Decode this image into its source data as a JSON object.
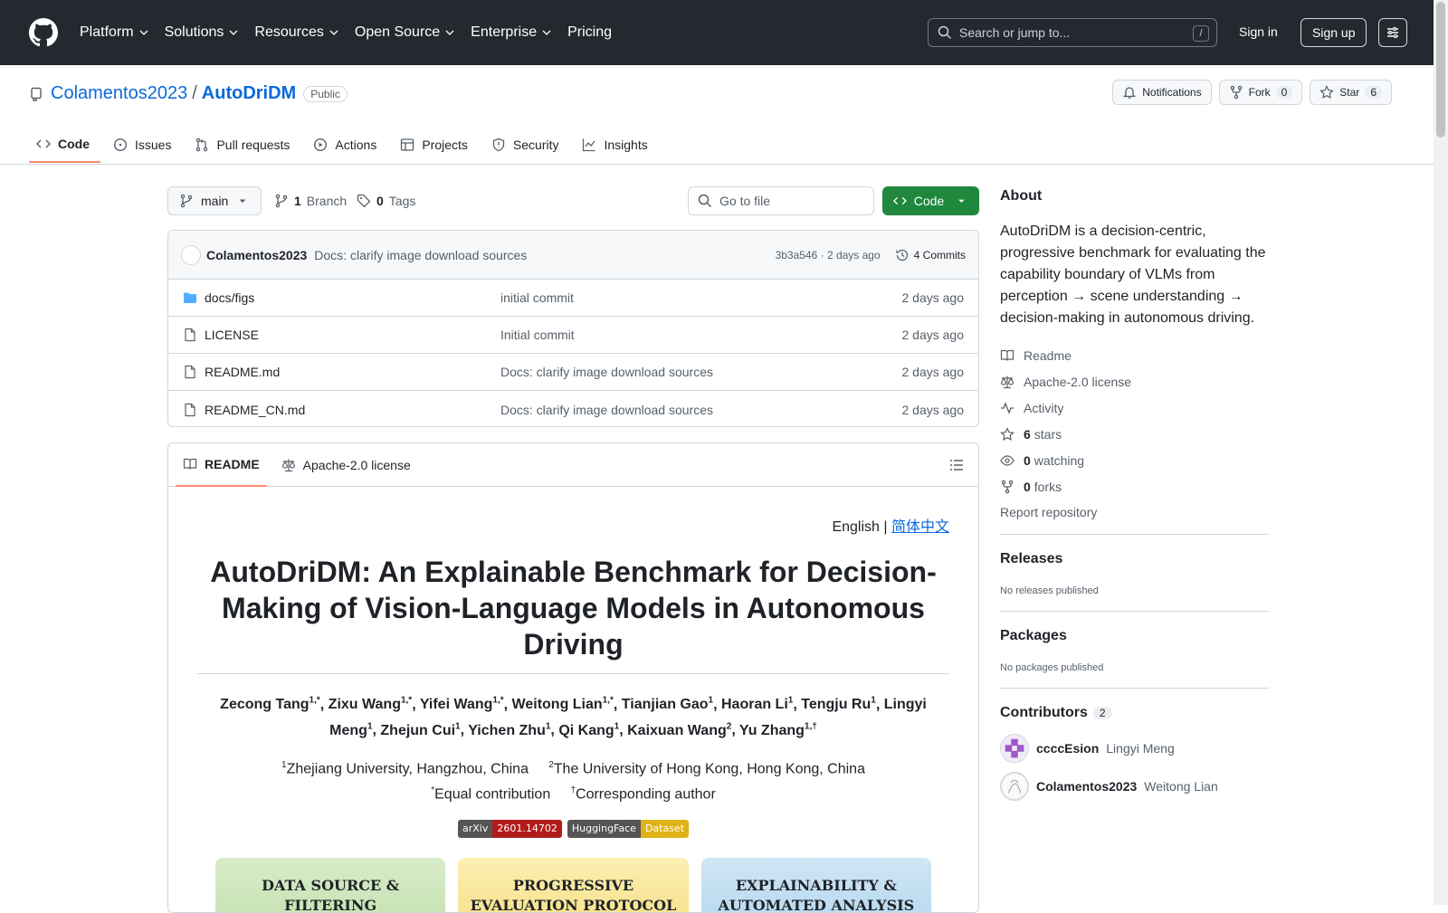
{
  "header": {
    "nav": [
      "Platform",
      "Solutions",
      "Resources",
      "Open Source",
      "Enterprise",
      "Pricing"
    ],
    "search_placeholder": "Search or jump to...",
    "search_shortcut": "/",
    "signin": "Sign in",
    "signup": "Sign up"
  },
  "repo": {
    "owner": "Colamentos2023",
    "separator": "/",
    "name": "AutoDriDM",
    "visibility": "Public",
    "notifications": "Notifications",
    "fork_label": "Fork",
    "fork_count": "0",
    "star_label": "Star",
    "star_count": "6"
  },
  "tabs": [
    "Code",
    "Issues",
    "Pull requests",
    "Actions",
    "Projects",
    "Security",
    "Insights"
  ],
  "toolbar": {
    "branch": "main",
    "branch_count": "1",
    "branch_label": "Branch",
    "tag_count": "0",
    "tag_label": "Tags",
    "goto_file": "Go to file",
    "code_button": "Code"
  },
  "commit": {
    "author": "Colamentos2023",
    "message": "Docs: clarify image download sources",
    "hash_time": "3b3a546 · 2 days ago",
    "commits": "4 Commits"
  },
  "files": [
    {
      "name": "docs/figs",
      "type": "folder",
      "message": "initial commit",
      "date": "2 days ago"
    },
    {
      "name": "LICENSE",
      "type": "file",
      "message": "Initial commit",
      "date": "2 days ago"
    },
    {
      "name": "README.md",
      "type": "file",
      "message": "Docs: clarify image download sources",
      "date": "2 days ago"
    },
    {
      "name": "README_CN.md",
      "type": "file",
      "message": "Docs: clarify image download sources",
      "date": "2 days ago"
    }
  ],
  "readme": {
    "tab_readme": "README",
    "tab_license": "Apache-2.0 license",
    "lang_english": "English |",
    "lang_chinese": "简体中文",
    "title": "AutoDriDM: An Explainable Benchmark for Decision-Making of Vision-Language Models in Autonomous Driving",
    "authors": [
      {
        "name": "Zecong Tang",
        "sup": "1,*"
      },
      {
        "name": "Zixu Wang",
        "sup": "1,*"
      },
      {
        "name": "Yifei Wang",
        "sup": "1,*"
      },
      {
        "name": "Weitong Lian",
        "sup": "1,*"
      },
      {
        "name": "Tianjian Gao",
        "sup": "1"
      },
      {
        "name": "Haoran Li",
        "sup": "1"
      },
      {
        "name": "Tengju Ru",
        "sup": "1"
      },
      {
        "name": "Lingyi Meng",
        "sup": "1"
      },
      {
        "name": "Zhejun Cui",
        "sup": "1"
      },
      {
        "name": "Yichen Zhu",
        "sup": "1"
      },
      {
        "name": "Qi Kang",
        "sup": "1"
      },
      {
        "name": "Kaixuan Wang",
        "sup": "2"
      },
      {
        "name": "Yu Zhang",
        "sup": "1,†"
      }
    ],
    "affil1_sup": "1",
    "affil1": "Zhejiang University, Hangzhou, China",
    "affil2_sup": "2",
    "affil2": "The University of Hong Kong, Hong Kong, China",
    "equal_sup": "*",
    "equal": "Equal contribution",
    "corr_sup": "†",
    "corr": "Corresponding author",
    "badge1_left": "arXiv",
    "badge1_right": "2601.14702",
    "badge2_left": "HuggingFace",
    "badge2_right": "Dataset",
    "banner1": "DATA SOURCE & FILTERING",
    "banner2": "PROGRESSIVE EVALUATION PROTOCOL",
    "banner3": "EXPLAINABILITY & AUTOMATED ANALYSIS"
  },
  "about": {
    "heading": "About",
    "description": "AutoDriDM is a decision-centric, progressive benchmark for evaluating the capability boundary of VLMs from perception → scene understanding → decision-making in autonomous driving.",
    "readme": "Readme",
    "license": "Apache-2.0 license",
    "activity": "Activity",
    "stars_count": "6",
    "stars_label": "stars",
    "watching_count": "0",
    "watching_label": "watching",
    "forks_count": "0",
    "forks_label": "forks",
    "report": "Report repository"
  },
  "releases": {
    "heading": "Releases",
    "empty": "No releases published"
  },
  "packages": {
    "heading": "Packages",
    "empty": "No packages published"
  },
  "contributors": {
    "heading": "Contributors",
    "count": "2",
    "list": [
      {
        "login": "ccccEsion",
        "name": "Lingyi Meng"
      },
      {
        "login": "Colamentos2023",
        "name": "Weitong Lian"
      }
    ]
  },
  "colors": {
    "header_bg": "#24292f",
    "accent_blue": "#0969da",
    "green": "#1f883d",
    "tab_underline": "#fd8c73"
  }
}
